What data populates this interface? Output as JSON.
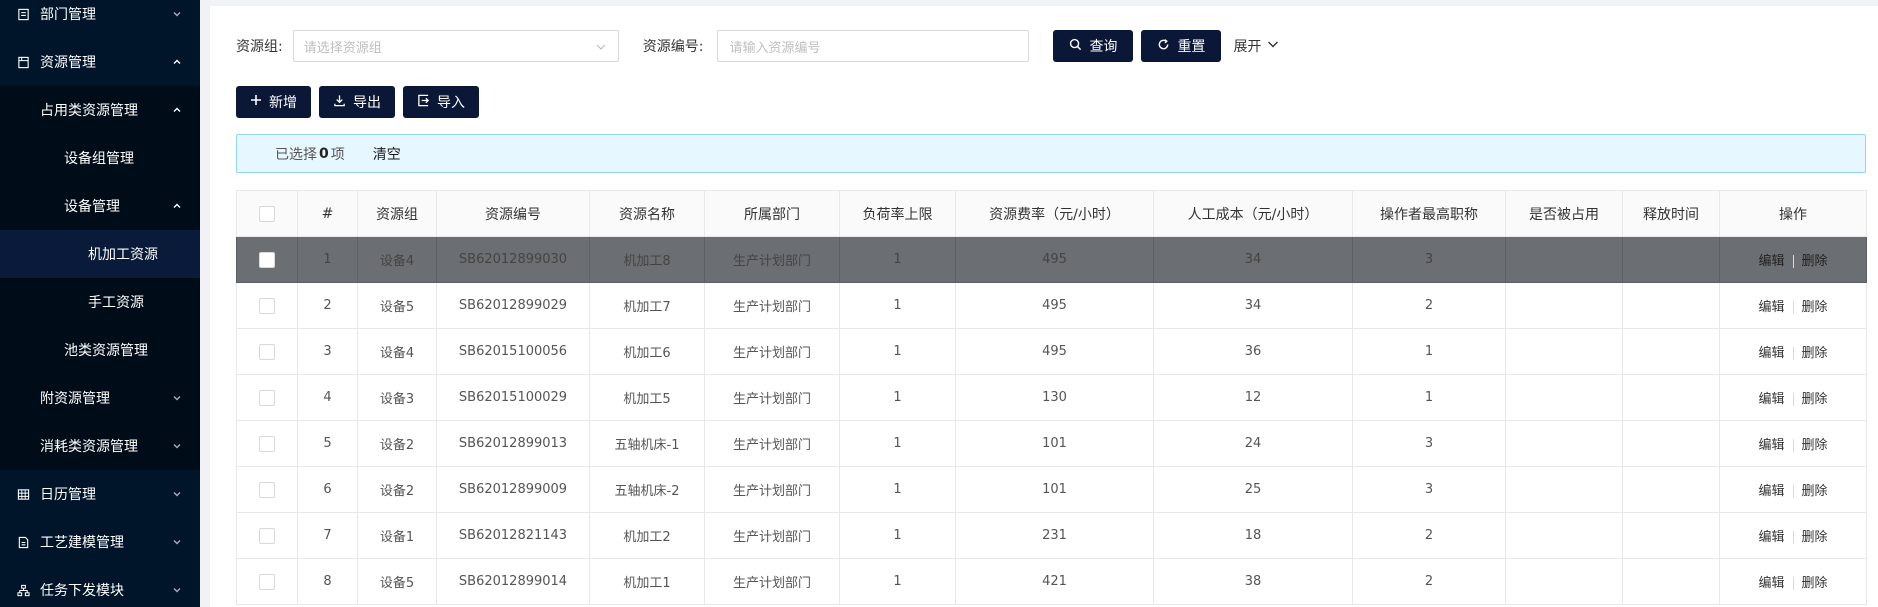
{
  "sidebar": {
    "items": [
      {
        "label": "部门管理",
        "level": 0,
        "icon": "document-icon",
        "arrow": "down"
      },
      {
        "label": "资源管理",
        "level": 0,
        "icon": "calendar-doc-icon",
        "arrow": "up"
      },
      {
        "label": "占用类资源管理",
        "level": 1,
        "arrow": "up"
      },
      {
        "label": "设备组管理",
        "level": 2
      },
      {
        "label": "设备管理",
        "level": 2,
        "arrow": "up"
      },
      {
        "label": "机加工资源",
        "level": 3,
        "active": true
      },
      {
        "label": "手工资源",
        "level": 3
      },
      {
        "label": "池类资源管理",
        "level": 2
      },
      {
        "label": "附资源管理",
        "level": 1,
        "arrow": "down"
      },
      {
        "label": "消耗类资源管理",
        "level": 1,
        "arrow": "down"
      },
      {
        "label": "日历管理",
        "level": 0,
        "icon": "grid-icon",
        "arrow": "down"
      },
      {
        "label": "工艺建模管理",
        "level": 0,
        "icon": "file-icon",
        "arrow": "down"
      },
      {
        "label": "任务下发模块",
        "level": 0,
        "icon": "org-icon",
        "arrow": "down"
      }
    ]
  },
  "search": {
    "group_label": "资源组:",
    "group_placeholder": "请选择资源组",
    "code_label": "资源编号:",
    "code_placeholder": "请输入资源编号",
    "query_label": "查询",
    "reset_label": "重置",
    "expand_label": "展开"
  },
  "actions": {
    "add_label": "新增",
    "export_label": "导出",
    "import_label": "导入"
  },
  "alert": {
    "prefix": "已选择",
    "count": "0",
    "suffix": "项",
    "clear_label": "清空"
  },
  "table": {
    "columns": [
      "",
      "#",
      "资源组",
      "资源编号",
      "资源名称",
      "所属部门",
      "负荷率上限",
      "资源费率（元/小时）",
      "人工成本（元/小时）",
      "操作者最高职称",
      "是否被占用",
      "释放时间",
      "操作"
    ],
    "edit_label": "编辑",
    "delete_label": "删除",
    "rows": [
      {
        "no": "1",
        "group": "设备4",
        "code": "SB62012899030",
        "name": "机加工8",
        "dept": "生产计划部门",
        "load": "1",
        "rate": "495",
        "labor": "34",
        "title": "3",
        "occupied": "",
        "release": "",
        "selected": true
      },
      {
        "no": "2",
        "group": "设备5",
        "code": "SB62012899029",
        "name": "机加工7",
        "dept": "生产计划部门",
        "load": "1",
        "rate": "495",
        "labor": "34",
        "title": "2",
        "occupied": "",
        "release": ""
      },
      {
        "no": "3",
        "group": "设备4",
        "code": "SB62015100056",
        "name": "机加工6",
        "dept": "生产计划部门",
        "load": "1",
        "rate": "495",
        "labor": "36",
        "title": "1",
        "occupied": "",
        "release": ""
      },
      {
        "no": "4",
        "group": "设备3",
        "code": "SB62015100029",
        "name": "机加工5",
        "dept": "生产计划部门",
        "load": "1",
        "rate": "130",
        "labor": "12",
        "title": "1",
        "occupied": "",
        "release": ""
      },
      {
        "no": "5",
        "group": "设备2",
        "code": "SB62012899013",
        "name": "五轴机床-1",
        "dept": "生产计划部门",
        "load": "1",
        "rate": "101",
        "labor": "24",
        "title": "3",
        "occupied": "",
        "release": ""
      },
      {
        "no": "6",
        "group": "设备2",
        "code": "SB62012899009",
        "name": "五轴机床-2",
        "dept": "生产计划部门",
        "load": "1",
        "rate": "101",
        "labor": "25",
        "title": "3",
        "occupied": "",
        "release": ""
      },
      {
        "no": "7",
        "group": "设备1",
        "code": "SB62012821143",
        "name": "机加工2",
        "dept": "生产计划部门",
        "load": "1",
        "rate": "231",
        "labor": "18",
        "title": "2",
        "occupied": "",
        "release": ""
      },
      {
        "no": "8",
        "group": "设备5",
        "code": "SB62012899014",
        "name": "机加工1",
        "dept": "生产计划部门",
        "load": "1",
        "rate": "421",
        "labor": "38",
        "title": "2",
        "occupied": "",
        "release": ""
      }
    ]
  }
}
